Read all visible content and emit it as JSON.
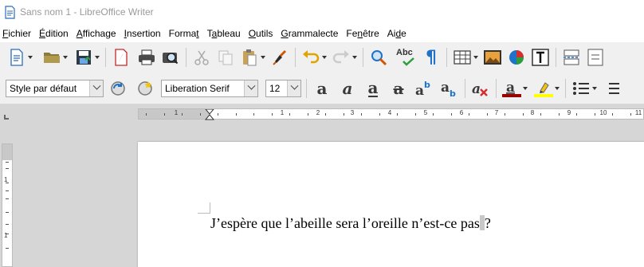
{
  "window": {
    "title": "Sans nom 1 - LibreOffice Writer"
  },
  "menu": [
    {
      "pre": "",
      "key": "F",
      "post": "ichier"
    },
    {
      "pre": "",
      "key": "É",
      "post": "dition"
    },
    {
      "pre": "",
      "key": "A",
      "post": "ffichage"
    },
    {
      "pre": "",
      "key": "I",
      "post": "nsertion"
    },
    {
      "pre": "Forma",
      "key": "t",
      "post": ""
    },
    {
      "pre": "T",
      "key": "a",
      "post": "bleau"
    },
    {
      "pre": "",
      "key": "O",
      "post": "utils"
    },
    {
      "pre": "",
      "key": "G",
      "post": "rammalecte"
    },
    {
      "pre": "Fe",
      "key": "n",
      "post": "être"
    },
    {
      "pre": "Ai",
      "key": "d",
      "post": "e"
    }
  ],
  "toolbar": {
    "paragraph_style": "Style par défaut",
    "font_name": "Liberation Serif",
    "font_size": "12",
    "spell_label": "Abc"
  },
  "ruler": {
    "h_numbers": [
      "1",
      "1",
      "2",
      "3",
      "4",
      "5",
      "6",
      "7",
      "8",
      "9",
      "10",
      "11"
    ],
    "v_numbers": [
      "1",
      "1"
    ]
  },
  "document": {
    "text_before": "J’espère que l’abeille sera l’oreille n’est-ce pas",
    "text_after": "?"
  },
  "colors": {
    "font_color": "#990000",
    "highlight_color": "#ffff00",
    "accent": "#1e72c8"
  }
}
